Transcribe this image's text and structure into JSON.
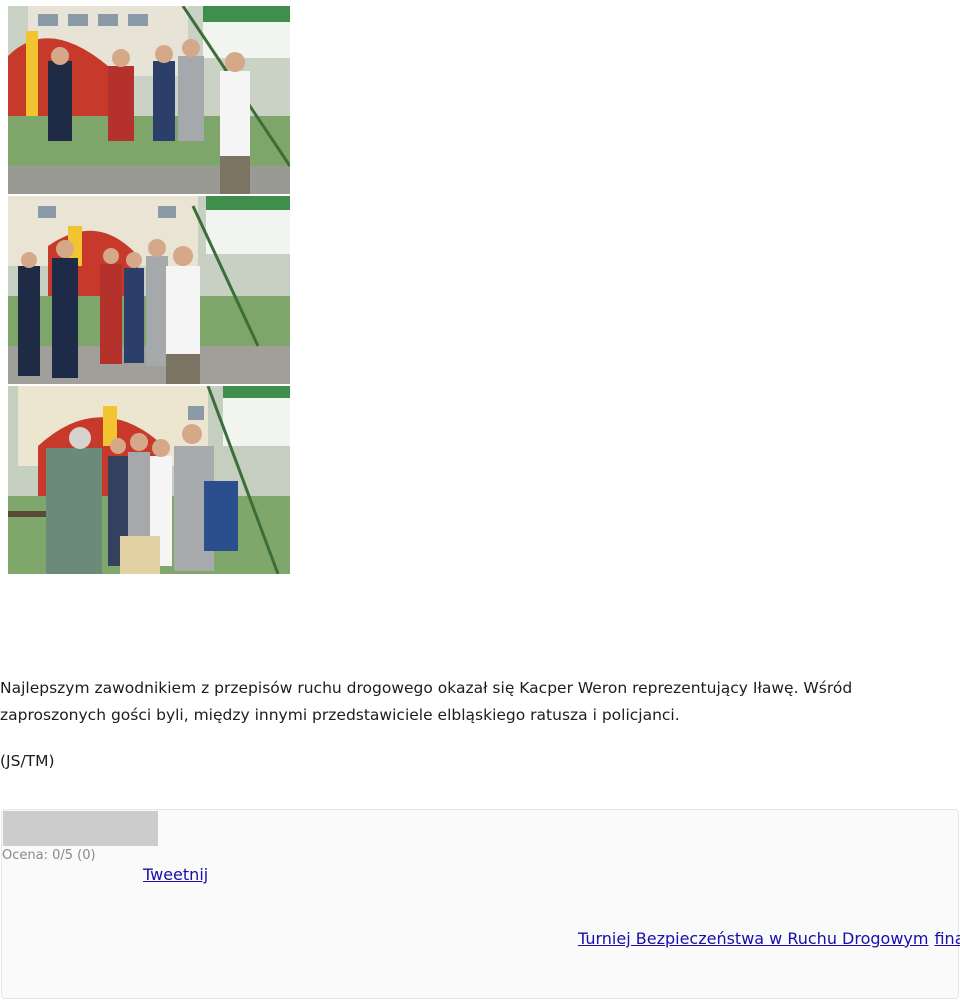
{
  "gallery": {
    "photos": [
      {
        "icon": "photo-award-ceremony-1"
      },
      {
        "icon": "photo-award-ceremony-2"
      },
      {
        "icon": "photo-award-ceremony-3"
      }
    ]
  },
  "article": {
    "paragraph": "Najlepszym zawodnikiem z przepisów ruchu drogowego okazał się Kacper Weron reprezentujący Iławę. Wśród zaproszonych gości byli, między innymi przedstawiciele elbląskiego ratusza i policjanci.",
    "signature": "(JS/TM)"
  },
  "meta": {
    "rating_text": "Ocena: 0/5 (0)",
    "rating_value": 0,
    "tweet_label": "Tweetnij",
    "tags": [
      "Turniej Bezpieczeństwa w Ruchu Drogowym",
      "finał"
    ]
  },
  "colors": {
    "link": "#1a0dab",
    "rating_bar": "#cccccc",
    "box_background": "#fafafa"
  }
}
